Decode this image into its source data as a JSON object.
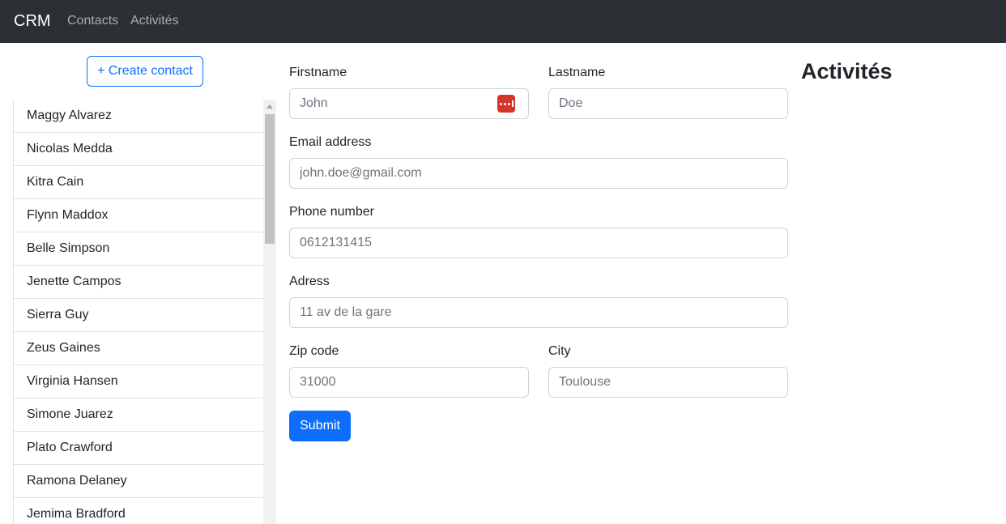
{
  "navbar": {
    "brand": "CRM",
    "links": [
      "Contacts",
      "Activités"
    ]
  },
  "sidebar": {
    "create_button": "+ Create contact",
    "contacts": [
      "Maggy Alvarez",
      "Nicolas Medda",
      "Kitra Cain",
      "Flynn Maddox",
      "Belle Simpson",
      "Jenette Campos",
      "Sierra Guy",
      "Zeus Gaines",
      "Virginia Hansen",
      "Simone Juarez",
      "Plato Crawford",
      "Ramona Delaney",
      "Jemima Bradford"
    ]
  },
  "form": {
    "firstname": {
      "label": "Firstname",
      "placeholder": "John",
      "value": ""
    },
    "lastname": {
      "label": "Lastname",
      "placeholder": "Doe",
      "value": ""
    },
    "email": {
      "label": "Email address",
      "placeholder": "john.doe@gmail.com",
      "value": ""
    },
    "phone": {
      "label": "Phone number",
      "placeholder": "0612131415",
      "value": ""
    },
    "address": {
      "label": "Adress",
      "placeholder": "11 av de la gare",
      "value": ""
    },
    "zip": {
      "label": "Zip code",
      "placeholder": "31000",
      "value": ""
    },
    "city": {
      "label": "City",
      "placeholder": "Toulouse",
      "value": ""
    },
    "submit_label": "Submit"
  },
  "activites": {
    "title": "Activités"
  },
  "colors": {
    "navbar_bg": "#2b3035",
    "primary": "#0d6efd",
    "password_manager_icon": "#d9342b"
  },
  "icons": {
    "password_manager": "password-manager-icon",
    "scroll_up": "chevron-up-icon"
  }
}
